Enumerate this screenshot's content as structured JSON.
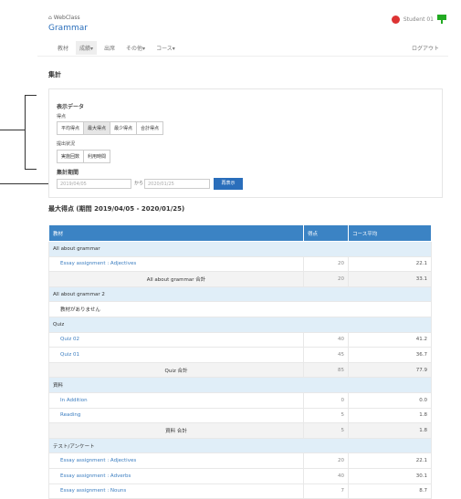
{
  "header": {
    "app_name": "WebClass",
    "course_title": "Grammar",
    "user_name": "Student 01"
  },
  "nav": {
    "items": [
      {
        "label": "教材",
        "active": false
      },
      {
        "label": "成績▾",
        "active": true
      },
      {
        "label": "出席",
        "active": false
      },
      {
        "label": "その他▾",
        "active": false
      },
      {
        "label": "コース▾",
        "active": false
      }
    ],
    "logout": "ログアウト"
  },
  "section_title": "集計",
  "form": {
    "display_data_label": "表示データ",
    "score_label": "得点",
    "score_buttons": [
      "平均得点",
      "最大得点",
      "最少得点",
      "合計得点"
    ],
    "score_active": 1,
    "target_label": "提出状況",
    "target_buttons": [
      "実施回数",
      "利用時間"
    ],
    "period_label": "集計期間",
    "date_from": "2019/04/05",
    "date_sep": "から",
    "date_to": "2020/01/25",
    "show_button": "再表示"
  },
  "report_title": "最大得点 (期間 2019/04/05 - 2020/01/25)",
  "table": {
    "headers": [
      "教材",
      "得点",
      "コース平均"
    ],
    "rows": [
      {
        "type": "group",
        "label": "All about grammar"
      },
      {
        "type": "item",
        "label": "Essay assignment : Adjectives",
        "score": "20",
        "avg": "22.1"
      },
      {
        "type": "subtotal",
        "label": "All about grammar 合計",
        "score": "20",
        "avg": "33.1"
      },
      {
        "type": "group",
        "label": "All about grammar 2"
      },
      {
        "type": "empty",
        "label": "教材がありません"
      },
      {
        "type": "group",
        "label": "Quiz"
      },
      {
        "type": "item",
        "label": "Quiz 02",
        "score": "40",
        "avg": "41.2"
      },
      {
        "type": "item",
        "label": "Quiz 01",
        "score": "45",
        "avg": "36.7"
      },
      {
        "type": "subtotal",
        "label": "Quiz 合計",
        "score": "85",
        "avg": "77.9"
      },
      {
        "type": "group",
        "label": "資料"
      },
      {
        "type": "item",
        "label": "In Addition",
        "score": "0",
        "avg": "0.0"
      },
      {
        "type": "item",
        "label": "Reading",
        "score": "5",
        "avg": "1.8"
      },
      {
        "type": "subtotal",
        "label": "資料 合計",
        "score": "5",
        "avg": "1.8"
      },
      {
        "type": "group",
        "label": "テスト/アンケート"
      },
      {
        "type": "item",
        "label": "Essay assignment : Adjectives",
        "score": "20",
        "avg": "22.1"
      },
      {
        "type": "item",
        "label": "Essay assignment : Adverbs",
        "score": "40",
        "avg": "30.1"
      },
      {
        "type": "item",
        "label": "Essay assignment : Nouns",
        "score": "7",
        "avg": "8.7"
      }
    ]
  }
}
